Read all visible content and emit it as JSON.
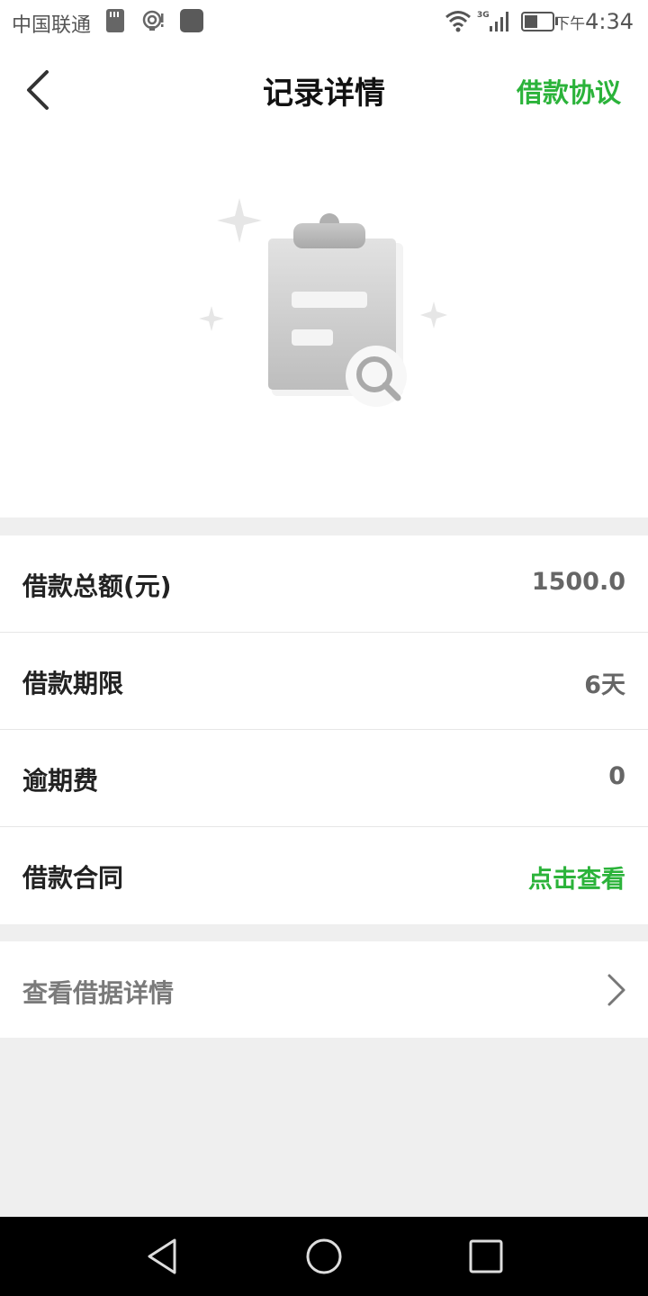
{
  "status_bar": {
    "carrier": "中国联通",
    "time_prefix": "下午",
    "time": "4:34",
    "network": "3G"
  },
  "header": {
    "title": "记录详情",
    "agreement_link": "借款协议"
  },
  "details": [
    {
      "label": "借款总额(元)",
      "value": "1500.0",
      "value_color": "#666666"
    },
    {
      "label": "借款期限",
      "value": "6天",
      "value_color": "#666666"
    },
    {
      "label": "逾期费",
      "value": "0",
      "value_color": "#666666"
    },
    {
      "label": "借款合同",
      "value": "点击查看",
      "value_color": "#2bb33a"
    }
  ],
  "receipt": {
    "label": "查看借据详情"
  },
  "icons": {
    "back": "chevron-left-icon",
    "illustration": "clipboard-search-icon",
    "receipt_arrow": "chevron-right-icon",
    "nav": [
      "triangle-back-icon",
      "circle-home-icon",
      "square-recent-icon"
    ]
  },
  "colors": {
    "accent": "#2bb33a",
    "background": "#efefef",
    "navbar": "#000000"
  }
}
